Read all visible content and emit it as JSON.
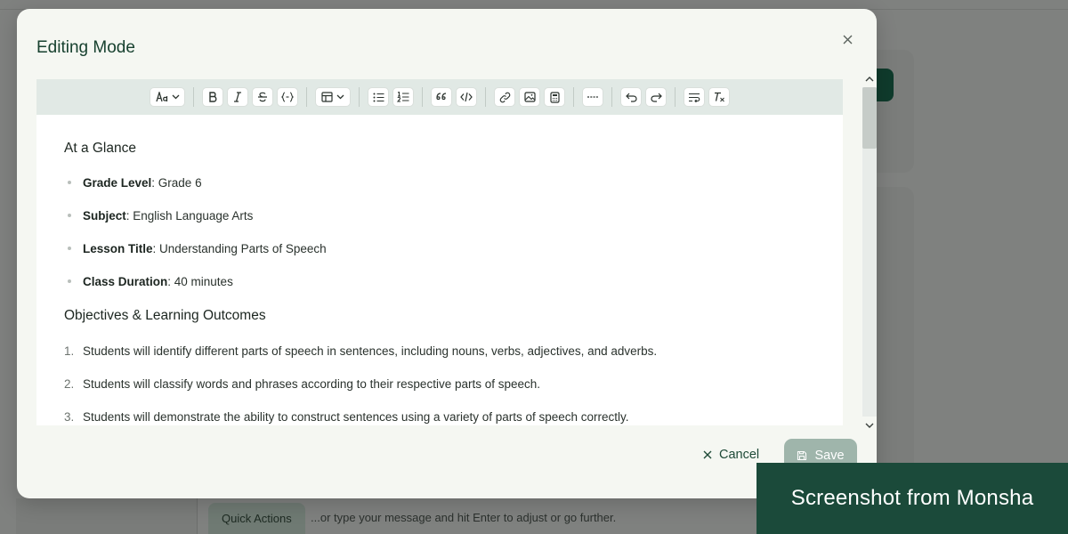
{
  "background": {
    "quick_actions_label": "Quick Actions",
    "chat_hint": "...or type your message and hit Enter to adjust or go further."
  },
  "modal": {
    "title": "Editing Mode",
    "cancel_label": "Cancel",
    "save_label": "Save"
  },
  "toolbar": {
    "groups": [
      [
        "text-style-dropdown"
      ],
      [
        "bold",
        "italic",
        "strikethrough",
        "code-inline"
      ],
      [
        "table-dropdown"
      ],
      [
        "bullet-list",
        "numbered-list"
      ],
      [
        "blockquote",
        "code-block"
      ],
      [
        "link",
        "image",
        "calculator"
      ],
      [
        "horizontal-rule"
      ],
      [
        "undo",
        "redo"
      ],
      [
        "text-wrap",
        "clear-formatting"
      ]
    ]
  },
  "editor": {
    "section1_title": "At a Glance",
    "glance_items": [
      {
        "label": "Grade Level",
        "value": ": Grade 6"
      },
      {
        "label": "Subject",
        "value": ": English Language Arts"
      },
      {
        "label": "Lesson Title",
        "value": ": Understanding Parts of Speech"
      },
      {
        "label": "Class Duration",
        "value": ": 40 minutes"
      }
    ],
    "section2_title": "Objectives & Learning Outcomes",
    "objectives": [
      {
        "num": "1.",
        "text": "Students will identify different parts of speech in sentences, including nouns, verbs, adjectives, and adverbs."
      },
      {
        "num": "2.",
        "text": "Students will classify words and phrases according to their respective parts of speech."
      },
      {
        "num": "3.",
        "text": "Students will demonstrate the ability to construct sentences using a variety of parts of speech correctly."
      }
    ]
  },
  "banner": {
    "text": "Screenshot from Monsha"
  },
  "colors": {
    "brand_dark_green": "#1b4a3a",
    "title_green": "#17412f",
    "save_disabled": "#9fb5ab"
  }
}
